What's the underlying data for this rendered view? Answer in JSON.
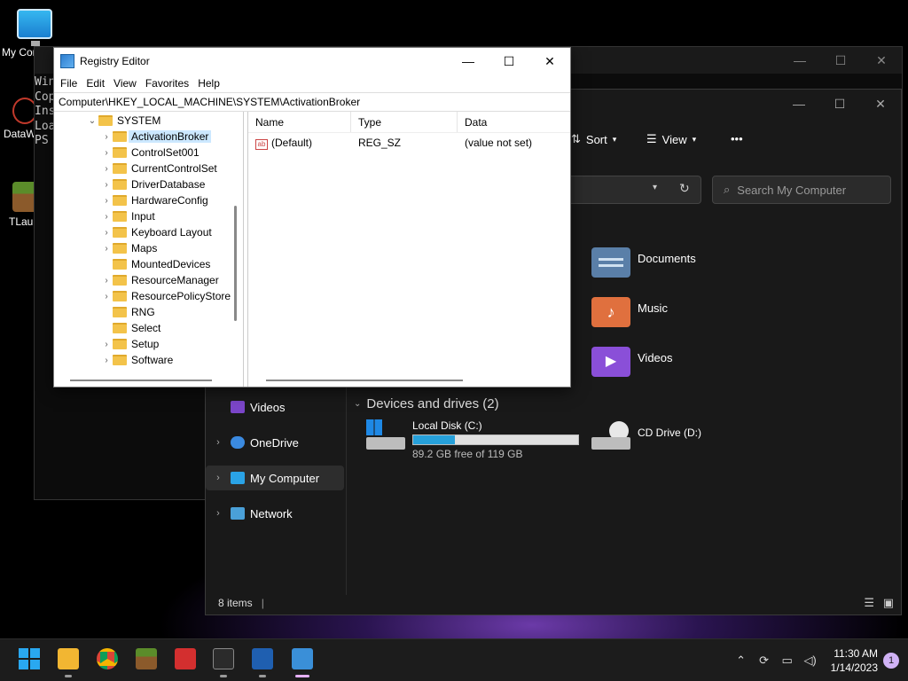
{
  "desktop": {
    "icons": [
      {
        "label": "My Computer"
      },
      {
        "label": "DataW"
      },
      {
        "label": "TLauncher"
      }
    ]
  },
  "console": {
    "lines": [
      "Win",
      "Cop",
      "",
      "Ins",
      "",
      "Loa",
      "PS"
    ]
  },
  "explorer": {
    "toolbar": {
      "sort_label": "Sort",
      "view_label": "View",
      "more_label": "•••"
    },
    "search": {
      "placeholder": "Search My Computer"
    },
    "nav": {
      "videos": "Videos",
      "onedrive": "OneDrive",
      "my_computer": "My Computer",
      "network": "Network"
    },
    "folders": {
      "documents": "Documents",
      "music": "Music",
      "videos": "Videos"
    },
    "devices_heading": "Devices and drives (2)",
    "drives": {
      "c_name": "Local Disk (C:)",
      "c_free": "89.2 GB free of 119 GB",
      "c_used_fraction": 0.25,
      "d_name": "CD Drive (D:)"
    },
    "status": {
      "items": "8 items"
    }
  },
  "regedit": {
    "title": "Registry Editor",
    "menu": [
      "File",
      "Edit",
      "View",
      "Favorites",
      "Help"
    ],
    "address": "Computer\\HKEY_LOCAL_MACHINE\\SYSTEM\\ActivationBroker",
    "tree": {
      "root": "SYSTEM",
      "children": [
        {
          "label": "ActivationBroker",
          "expandable": true,
          "selected": true
        },
        {
          "label": "ControlSet001",
          "expandable": true
        },
        {
          "label": "CurrentControlSet",
          "expandable": true
        },
        {
          "label": "DriverDatabase",
          "expandable": true
        },
        {
          "label": "HardwareConfig",
          "expandable": true
        },
        {
          "label": "Input",
          "expandable": true
        },
        {
          "label": "Keyboard Layout",
          "expandable": true
        },
        {
          "label": "Maps",
          "expandable": true
        },
        {
          "label": "MountedDevices",
          "expandable": false
        },
        {
          "label": "ResourceManager",
          "expandable": true
        },
        {
          "label": "ResourcePolicyStore",
          "expandable": true
        },
        {
          "label": "RNG",
          "expandable": false
        },
        {
          "label": "Select",
          "expandable": false
        },
        {
          "label": "Setup",
          "expandable": true
        },
        {
          "label": "Software",
          "expandable": true
        }
      ]
    },
    "columns": {
      "name": "Name",
      "type": "Type",
      "data": "Data"
    },
    "values": [
      {
        "icon": "ab",
        "name": "(Default)",
        "type": "REG_SZ",
        "data": "(value not set)"
      }
    ]
  },
  "taskbar": {
    "time": "11:30 AM",
    "date": "1/14/2023",
    "notification_count": "1"
  },
  "colors": {
    "accent": "#26a0da",
    "selection": "#cce8ff",
    "folder": "#f3c34a"
  }
}
